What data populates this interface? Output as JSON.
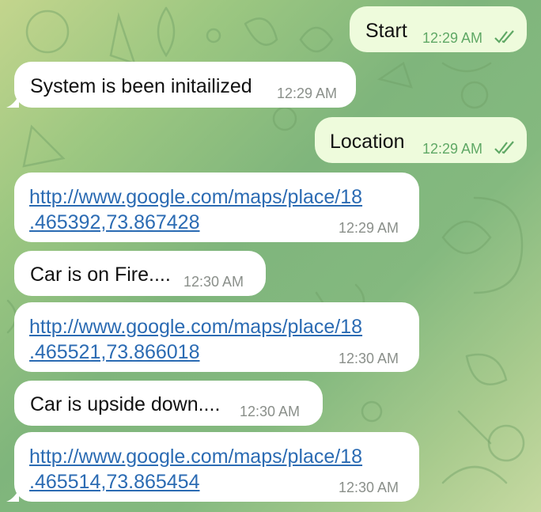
{
  "messages": [
    {
      "direction": "out",
      "text": "Start",
      "time": "12:29 AM",
      "status_icon": "double-check-icon"
    },
    {
      "direction": "in",
      "text": "System is been initailized",
      "time": "12:29 AM"
    },
    {
      "direction": "out",
      "text": "Location",
      "time": "12:29 AM",
      "status_icon": "double-check-icon"
    },
    {
      "direction": "in",
      "type": "link",
      "line1": "http://www.google.com/maps/place/18",
      "line2": ".465392,73.867428",
      "time": "12:29 AM"
    },
    {
      "direction": "in",
      "text": "Car is on Fire....",
      "time": "12:30 AM"
    },
    {
      "direction": "in",
      "type": "link",
      "line1": "http://www.google.com/maps/place/18",
      "line2": ".465521,73.866018",
      "time": "12:30 AM"
    },
    {
      "direction": "in",
      "text": "Car is upside down....",
      "time": "12:30 AM"
    },
    {
      "direction": "in",
      "type": "link",
      "line1": "http://www.google.com/maps/place/18",
      "line2": ".465514,73.865454",
      "time": "12:30 AM"
    }
  ],
  "colors": {
    "incoming_bubble": "#ffffff",
    "outgoing_bubble": "#eefbdc",
    "link": "#2b6bb3",
    "timestamp": "#8a8f8a",
    "outgoing_timestamp": "#5fa865",
    "background": "#8fbf7f"
  }
}
